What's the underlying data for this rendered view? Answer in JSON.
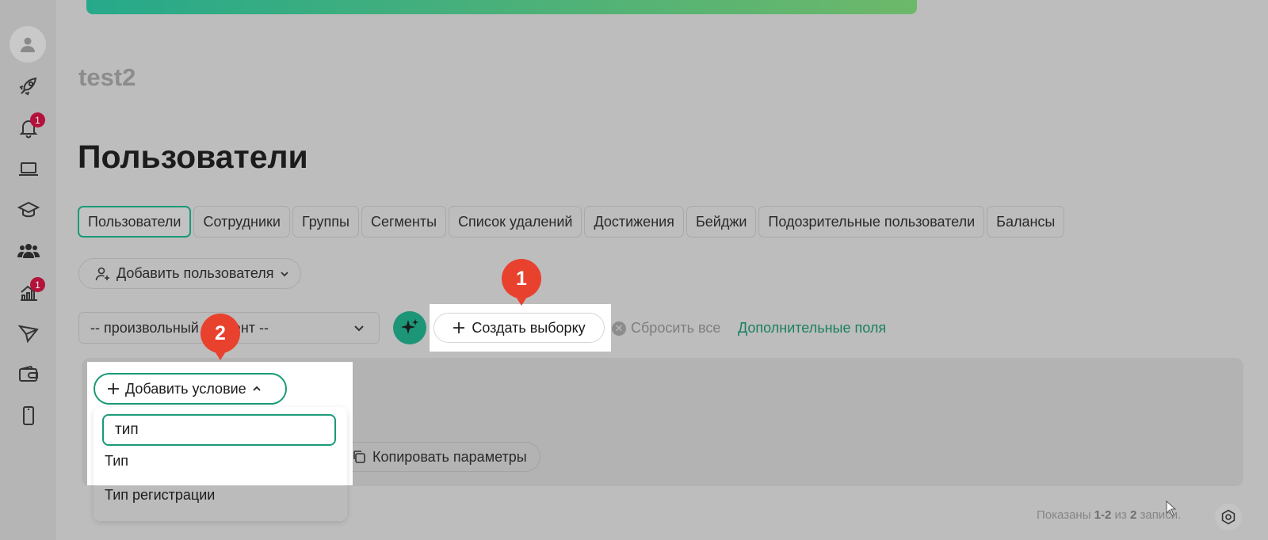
{
  "org_title": "test2",
  "page_title": "Пользователи",
  "sidebar": {
    "items": [
      {
        "name": "profile-icon",
        "badge": ""
      },
      {
        "name": "rocket-icon",
        "badge": ""
      },
      {
        "name": "bell-icon",
        "badge": "1"
      },
      {
        "name": "laptop-icon",
        "badge": ""
      },
      {
        "name": "graduation-cap-icon",
        "badge": ""
      },
      {
        "name": "users-icon",
        "badge": ""
      },
      {
        "name": "chart-icon",
        "badge": "1"
      },
      {
        "name": "send-icon",
        "badge": ""
      },
      {
        "name": "wallet-icon",
        "badge": ""
      },
      {
        "name": "phone-icon",
        "badge": ""
      }
    ]
  },
  "tabs": [
    "Пользователи",
    "Сотрудники",
    "Группы",
    "Сегменты",
    "Список удалений",
    "Достижения",
    "Бейджи",
    "Подозрительные пользователи",
    "Балансы"
  ],
  "add_user_label": "Добавить пользователя",
  "segment_select_value": "-- произвольный сегмент --",
  "create_selection_label": "Создать выборку",
  "reset_all_label": "Сбросить все",
  "extra_fields_label": "Дополнительные поля",
  "add_condition_label": "Добавить условие",
  "search_value": "тип",
  "dropdown_options": [
    "Тип",
    "Тип регистрации"
  ],
  "copy_params_label": "Копировать параметры",
  "pagination": {
    "prefix": "Показаны",
    "range": "1-2",
    "of": "из",
    "total": "2",
    "suffix": "записи."
  },
  "markers": [
    "1",
    "2"
  ],
  "colors": {
    "accent": "#1a9a78",
    "badge": "#b3123a",
    "marker": "#e8412e",
    "link": "#1b7f61"
  }
}
